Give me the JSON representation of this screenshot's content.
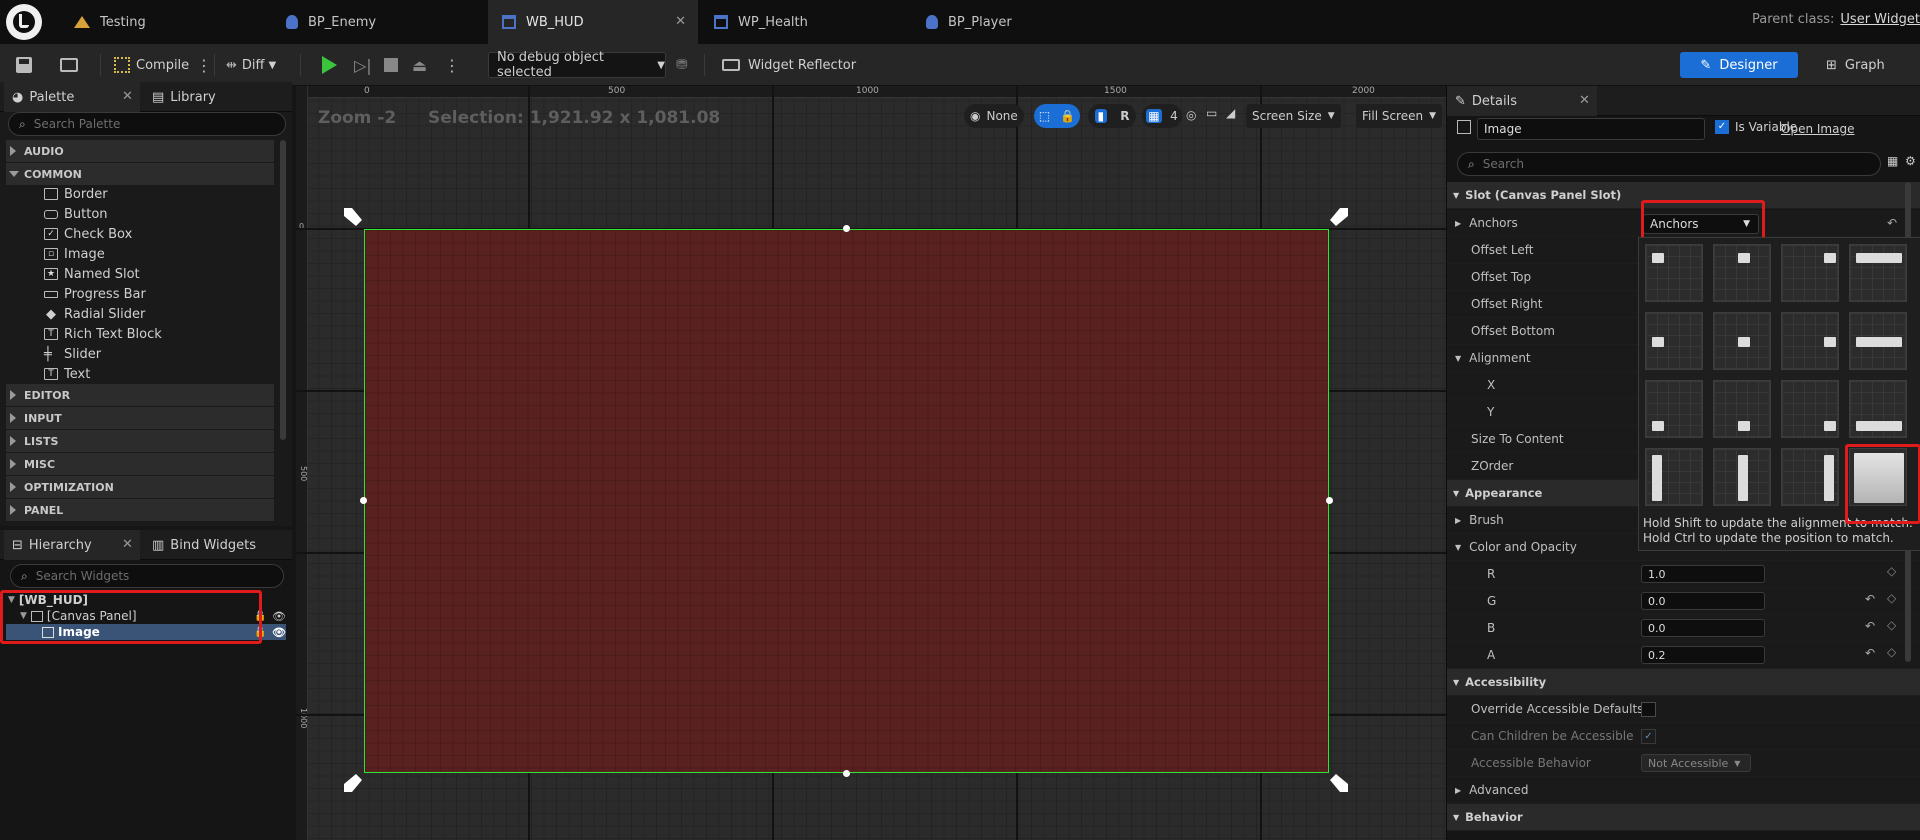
{
  "tabs": [
    {
      "label": "Testing"
    },
    {
      "label": "BP_Enemy"
    },
    {
      "label": "WB_HUD",
      "active": true
    },
    {
      "label": "WP_Health"
    },
    {
      "label": "BP_Player"
    }
  ],
  "parent_class": {
    "label": "Parent class:",
    "value": "User Widget"
  },
  "toolbar": {
    "compile": "Compile",
    "diff": "Diff",
    "debug_select": "No debug object selected",
    "widget_reflector": "Widget Reflector",
    "designer": "Designer",
    "graph": "Graph"
  },
  "palette": {
    "tab": "Palette",
    "library_tab": "Library",
    "search_placeholder": "Search Palette",
    "categories_top": [
      "AUDIO",
      "COMMON"
    ],
    "common_items": [
      "Border",
      "Button",
      "Check Box",
      "Image",
      "Named Slot",
      "Progress Bar",
      "Radial Slider",
      "Rich Text Block",
      "Slider",
      "Text"
    ],
    "categories_bottom": [
      "EDITOR",
      "INPUT",
      "LISTS",
      "MISC",
      "OPTIMIZATION",
      "PANEL"
    ]
  },
  "hierarchy": {
    "tab": "Hierarchy",
    "bind_tab": "Bind Widgets",
    "search_placeholder": "Search Widgets",
    "root": "[WB_HUD]",
    "canvas": "[Canvas Panel]",
    "image": "Image"
  },
  "designer": {
    "zoom": "Zoom -2",
    "selection": "Selection: 1,921.92 x 1,081.08",
    "ruler_top": [
      "0",
      "500",
      "1000",
      "1500",
      "2000"
    ],
    "ruler_left": [
      "0",
      "500",
      "1000"
    ],
    "none_label": "None",
    "r_label": "R",
    "grid_snap": "4",
    "screen_size": "Screen Size",
    "fill_screen": "Fill Screen"
  },
  "details": {
    "tab": "Details",
    "name_value": "Image",
    "is_variable": "Is Variable",
    "open_image": "Open Image",
    "search_placeholder": "Search",
    "slot_section": "Slot (Canvas Panel Slot)",
    "anchors_label": "Anchors",
    "anchors_dropdown": "Anchors",
    "rows": [
      "Offset Left",
      "Offset Top",
      "Offset Right",
      "Offset Bottom"
    ],
    "alignment": "Alignment",
    "x": "X",
    "y": "Y",
    "size_to_content": "Size To Content",
    "zorder": "ZOrder",
    "appearance": "Appearance",
    "brush": "Brush",
    "color_opacity": "Color and Opacity",
    "r": {
      "label": "R",
      "value": "1.0"
    },
    "g": {
      "label": "G",
      "value": "0.0"
    },
    "b": {
      "label": "B",
      "value": "0.0"
    },
    "a": {
      "label": "A",
      "value": "0.2"
    },
    "accessibility": "Accessibility",
    "override_accessible": "Override Accessible Defaults",
    "can_children": "Can Children be Accessible",
    "accessible_behavior": "Accessible Behavior",
    "accessible_value": "Not Accessible",
    "advanced": "Advanced",
    "behavior": "Behavior",
    "hint_line1": "Hold Shift to update the alignment to match.",
    "hint_line2": "Hold Ctrl to update the position to match."
  },
  "colors": {
    "accent": "#1a6ed6",
    "highlight": "#e01b1b",
    "selection_green": "#2fe52f",
    "image_fill": "#5a2121"
  }
}
